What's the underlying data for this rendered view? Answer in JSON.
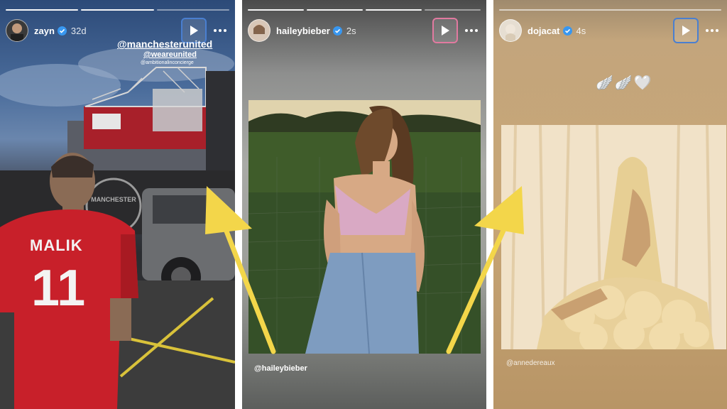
{
  "stories": [
    {
      "username": "zayn",
      "time": "32d",
      "stickers": [
        "@manchesterunited",
        "@weareunited",
        "@ambitionalinconcierge"
      ],
      "jersey_name": "MALIK",
      "jersey_number": "11",
      "progress_segments": 3,
      "active_segment": 1
    },
    {
      "username": "haileybieber",
      "time": "2s",
      "mention": "@haileybieber",
      "progress_segments": 4,
      "active_segment": 2
    },
    {
      "username": "dojacat",
      "time": "4s",
      "emojis": "🪽🪽🤍",
      "mention": "@annedereaux",
      "progress_segments": 1,
      "active_segment": 0
    }
  ],
  "colors": {
    "play_highlight_1": "#4a7fd0",
    "play_highlight_2": "#e27aa0",
    "play_highlight_3": "#4a7fd0",
    "arrow": "#f3d64a",
    "verified": "#3897f0"
  },
  "icons": {
    "play": "play-icon",
    "more": "more-options-icon",
    "verified": "verified-badge-icon"
  }
}
